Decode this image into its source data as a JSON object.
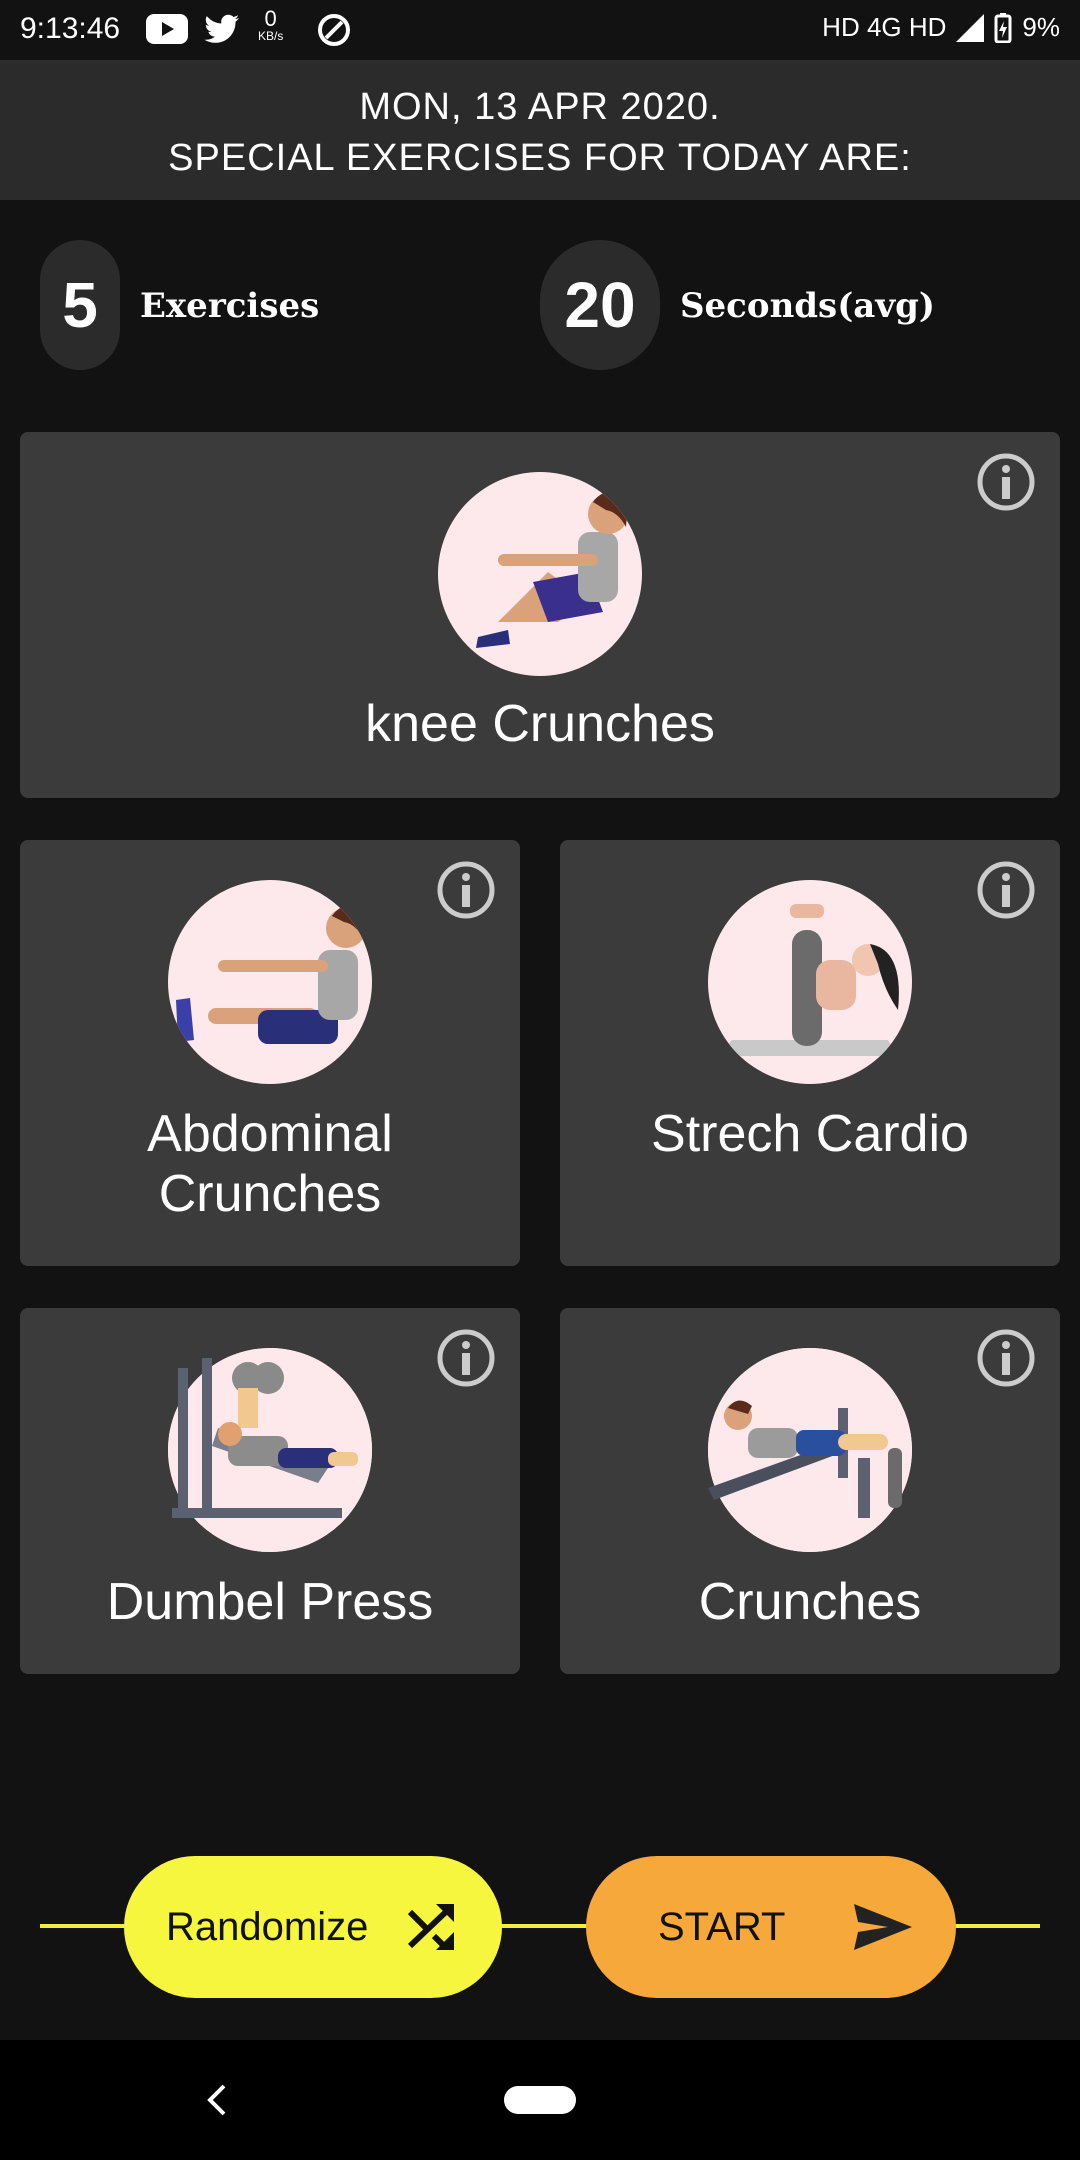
{
  "status_bar": {
    "time": "9:13:46",
    "speed_value": "0",
    "speed_unit": "KB/s",
    "network": "HD 4G HD",
    "battery": "9%"
  },
  "header": {
    "date": "MON, 13 APR 2020.",
    "subtitle": "SPECIAL EXERCISES FOR TODAY ARE:"
  },
  "stats": {
    "exercises_count": "5",
    "exercises_label": "Exercises",
    "seconds_value": "20",
    "seconds_label": "Seconds(avg)"
  },
  "exercises": [
    {
      "title": "knee Crunches",
      "icon": "knee-crunch-figure"
    },
    {
      "title_line1": "Abdominal",
      "title_line2": "Crunches",
      "icon": "abdominal-crunch-figure"
    },
    {
      "title": "Strech Cardio",
      "icon": "stretch-cardio-figure"
    },
    {
      "title": "Dumbel Press",
      "icon": "dumbbell-press-figure"
    },
    {
      "title": "Crunches",
      "icon": "bench-crunch-figure"
    }
  ],
  "buttons": {
    "randomize_label": "Randomize",
    "start_label": "START"
  },
  "colors": {
    "background": "#121212",
    "card": "#3b3b3b",
    "header": "#2b2b2b",
    "randomize": "#f6f63f",
    "start": "#f6a93a",
    "avatar_bg": "#fde9ec"
  }
}
